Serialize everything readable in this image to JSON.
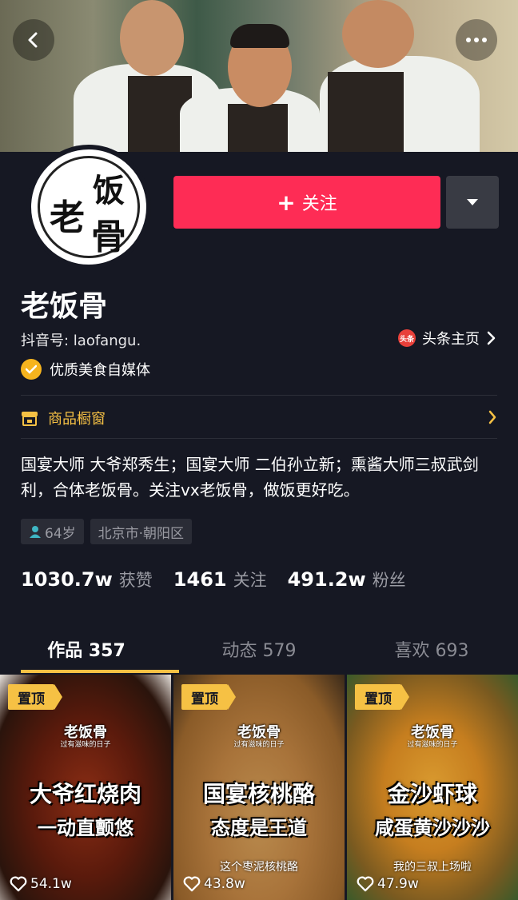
{
  "profile": {
    "name": "老饭骨",
    "douyin_id": "抖音号: laofangu.",
    "toutiao_link": "头条主页",
    "toutiao_icon_text": "头条",
    "verified_label": "优质美食自媒体",
    "avatar_logo_chars": [
      "老",
      "饭",
      "骨"
    ]
  },
  "actions": {
    "follow_label": "关注",
    "follow_plus": "+"
  },
  "shop": {
    "label": "商品橱窗"
  },
  "bio": "国宴大师 大爷郑秀生；国宴大师 二伯孙立新；熏酱大师三叔武剑利，合体老饭骨。关注vx老饭骨，做饭更好吃。",
  "tags": {
    "age": "64岁",
    "location": "北京市·朝阳区"
  },
  "stats": {
    "likes_num": "1030.7w",
    "likes_label": "获赞",
    "following_num": "1461",
    "following_label": "关注",
    "fans_num": "491.2w",
    "fans_label": "粉丝"
  },
  "tabs": [
    {
      "label": "作品 357",
      "active": true
    },
    {
      "label": "动态 579",
      "active": false
    },
    {
      "label": "喜欢 693",
      "active": false
    }
  ],
  "videos": [
    {
      "pin": "置顶",
      "brand": "老饭骨",
      "brand_sub": "过有滋味的日子",
      "title1": "大爷红烧肉",
      "title2": "一动直颤悠",
      "title3": "",
      "likes": "54.1w"
    },
    {
      "pin": "置顶",
      "brand": "老饭骨",
      "brand_sub": "过有滋味的日子",
      "title1": "国宴核桃酪",
      "title2": "态度是王道",
      "title3": "这个枣泥核桃酪",
      "likes": "43.8w"
    },
    {
      "pin": "置顶",
      "brand": "老饭骨",
      "brand_sub": "过有滋味的日子",
      "title1": "金沙虾球",
      "title2": "咸蛋黄沙沙沙",
      "title3": "我的三叔上场啦",
      "likes": "47.9w"
    }
  ],
  "colors": {
    "background": "#161823",
    "follow_button": "#fe2c55",
    "accent_yellow": "#f6c144",
    "muted_text": "#9a9ba3"
  }
}
